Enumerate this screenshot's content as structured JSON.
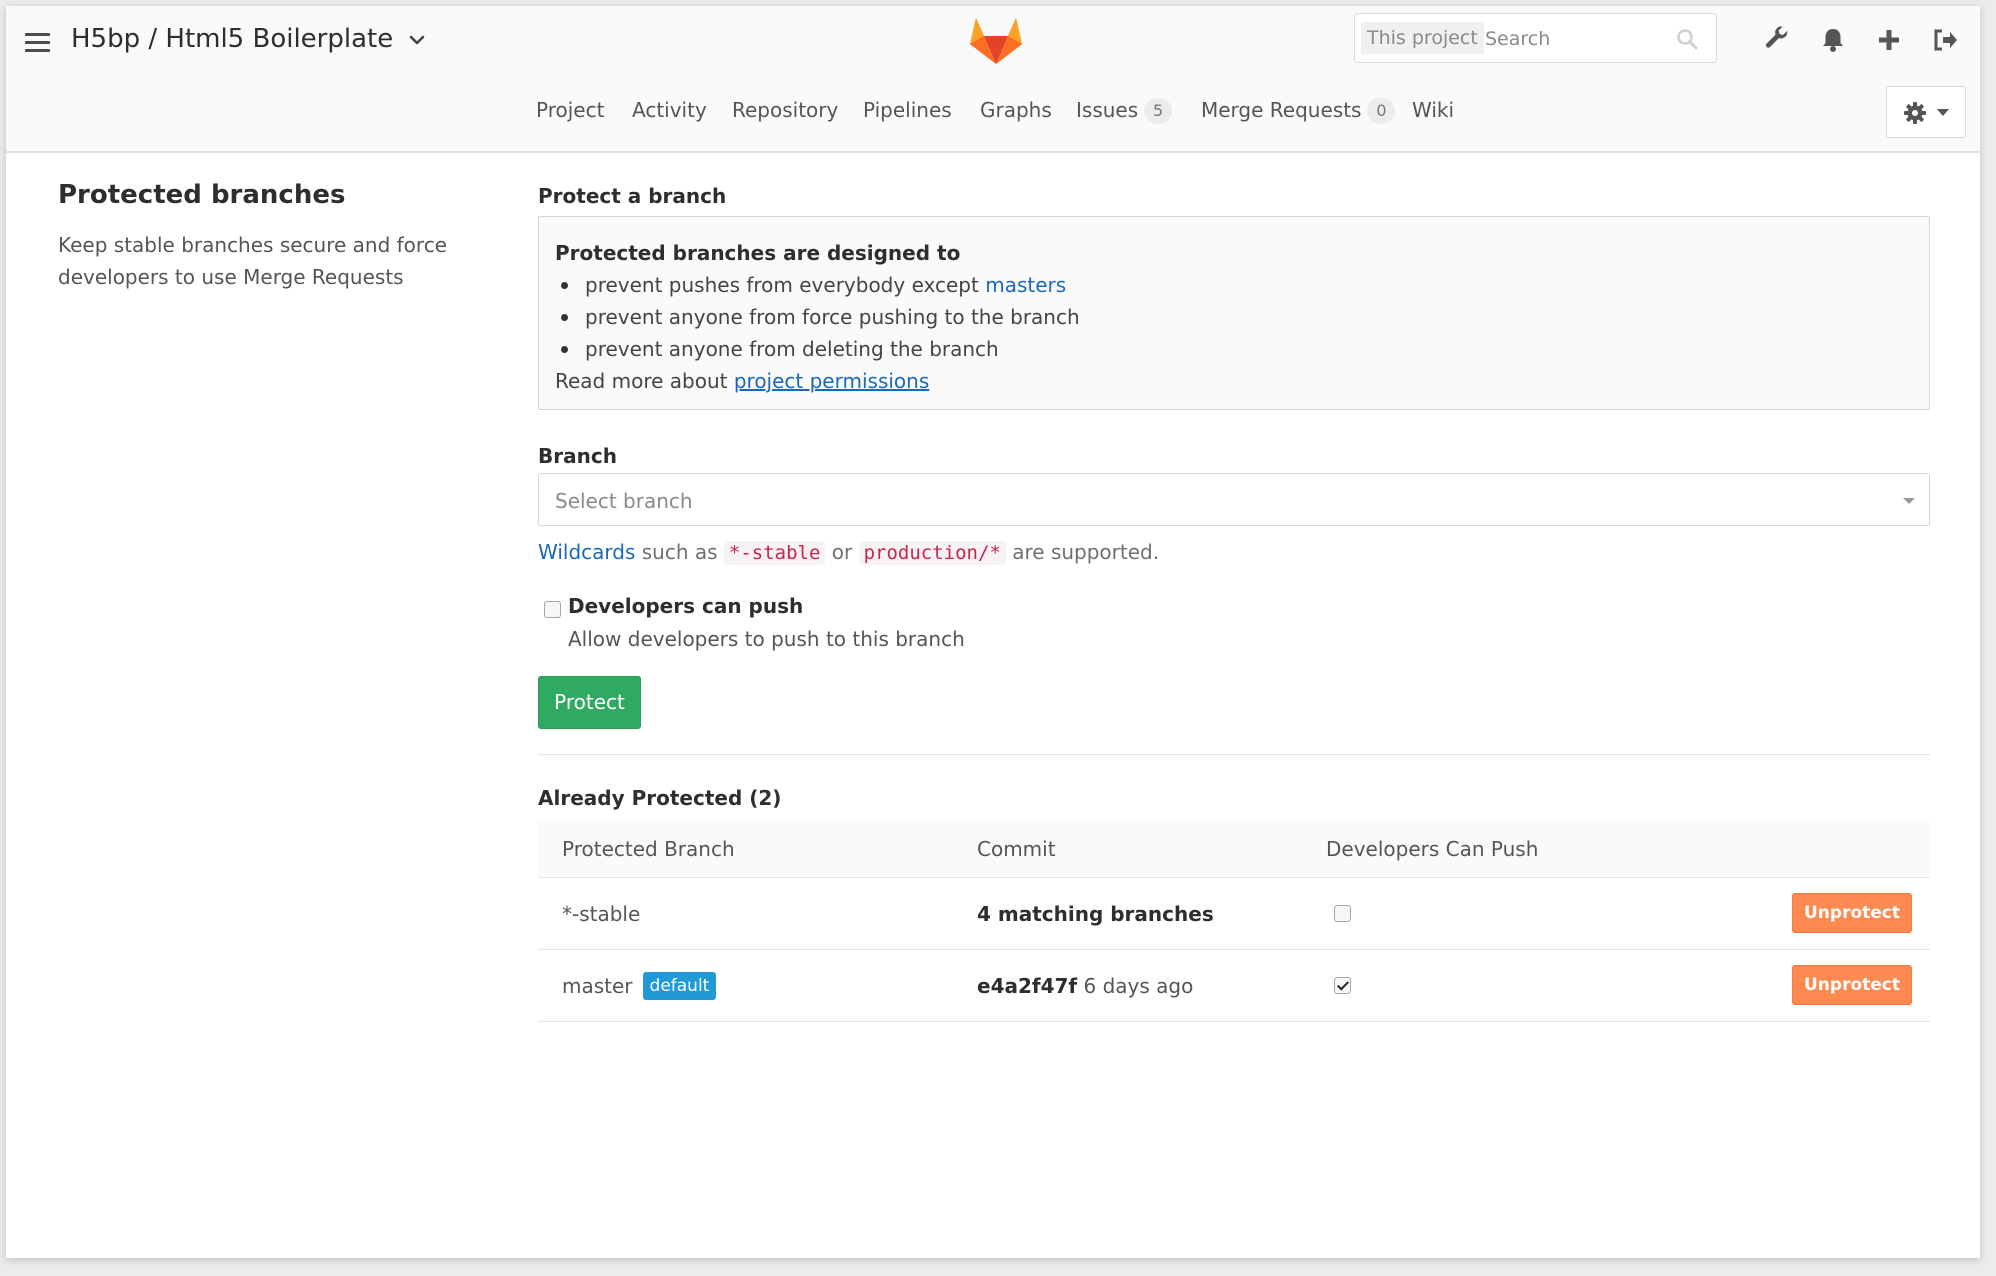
{
  "header": {
    "project_title": "H5bp / Html5 Boilerplate",
    "search": {
      "scope": "This project",
      "placeholder": "Search"
    },
    "icons": [
      "wrench-icon",
      "bell-icon",
      "plus-icon",
      "sign-out-icon"
    ]
  },
  "nav": {
    "tabs": [
      {
        "label": "Project"
      },
      {
        "label": "Activity"
      },
      {
        "label": "Repository"
      },
      {
        "label": "Pipelines"
      },
      {
        "label": "Graphs"
      },
      {
        "label": "Issues",
        "count": "5"
      },
      {
        "label": "Merge Requests",
        "count": "0"
      },
      {
        "label": "Wiki"
      }
    ]
  },
  "sidebar": {
    "title": "Protected branches",
    "description": "Keep stable branches secure and force developers to use Merge Requests"
  },
  "protect": {
    "heading": "Protect a branch",
    "info_title": "Protected branches are designed to",
    "bullet1_prefix": "prevent pushes from everybody except ",
    "bullet1_link": "masters",
    "bullet2": "prevent anyone from force pushing to the branch",
    "bullet3": "prevent anyone from deleting the branch",
    "read_more_prefix": "Read more about ",
    "read_more_link": "project permissions",
    "branch_label": "Branch",
    "branch_placeholder": "Select branch",
    "wildcards_link": "Wildcards",
    "hint_such_as": " such as ",
    "hint_code1": "*-stable",
    "hint_or": " or ",
    "hint_code2": "production/*",
    "hint_supported": " are supported.",
    "dev_push_label": "Developers can push",
    "dev_push_desc": "Allow developers to push to this branch",
    "protect_button": "Protect"
  },
  "protected": {
    "heading": "Already Protected (2)",
    "columns": [
      "Protected Branch",
      "Commit",
      "Developers Can Push"
    ],
    "rows": [
      {
        "branch": "*-stable",
        "badge": "",
        "commit": "4 matching branches",
        "commit_time": "",
        "dev_can_push": false,
        "action": "Unprotect"
      },
      {
        "branch": "master",
        "badge": "default",
        "commit": "e4a2f47f",
        "commit_time": " 6 days ago",
        "dev_can_push": true,
        "action": "Unprotect"
      }
    ]
  },
  "colors": {
    "protect_button": "#2faa60",
    "unprotect_button": "#fc8a51",
    "default_badge": "#1f9ad6",
    "link": "#1b69b6"
  }
}
